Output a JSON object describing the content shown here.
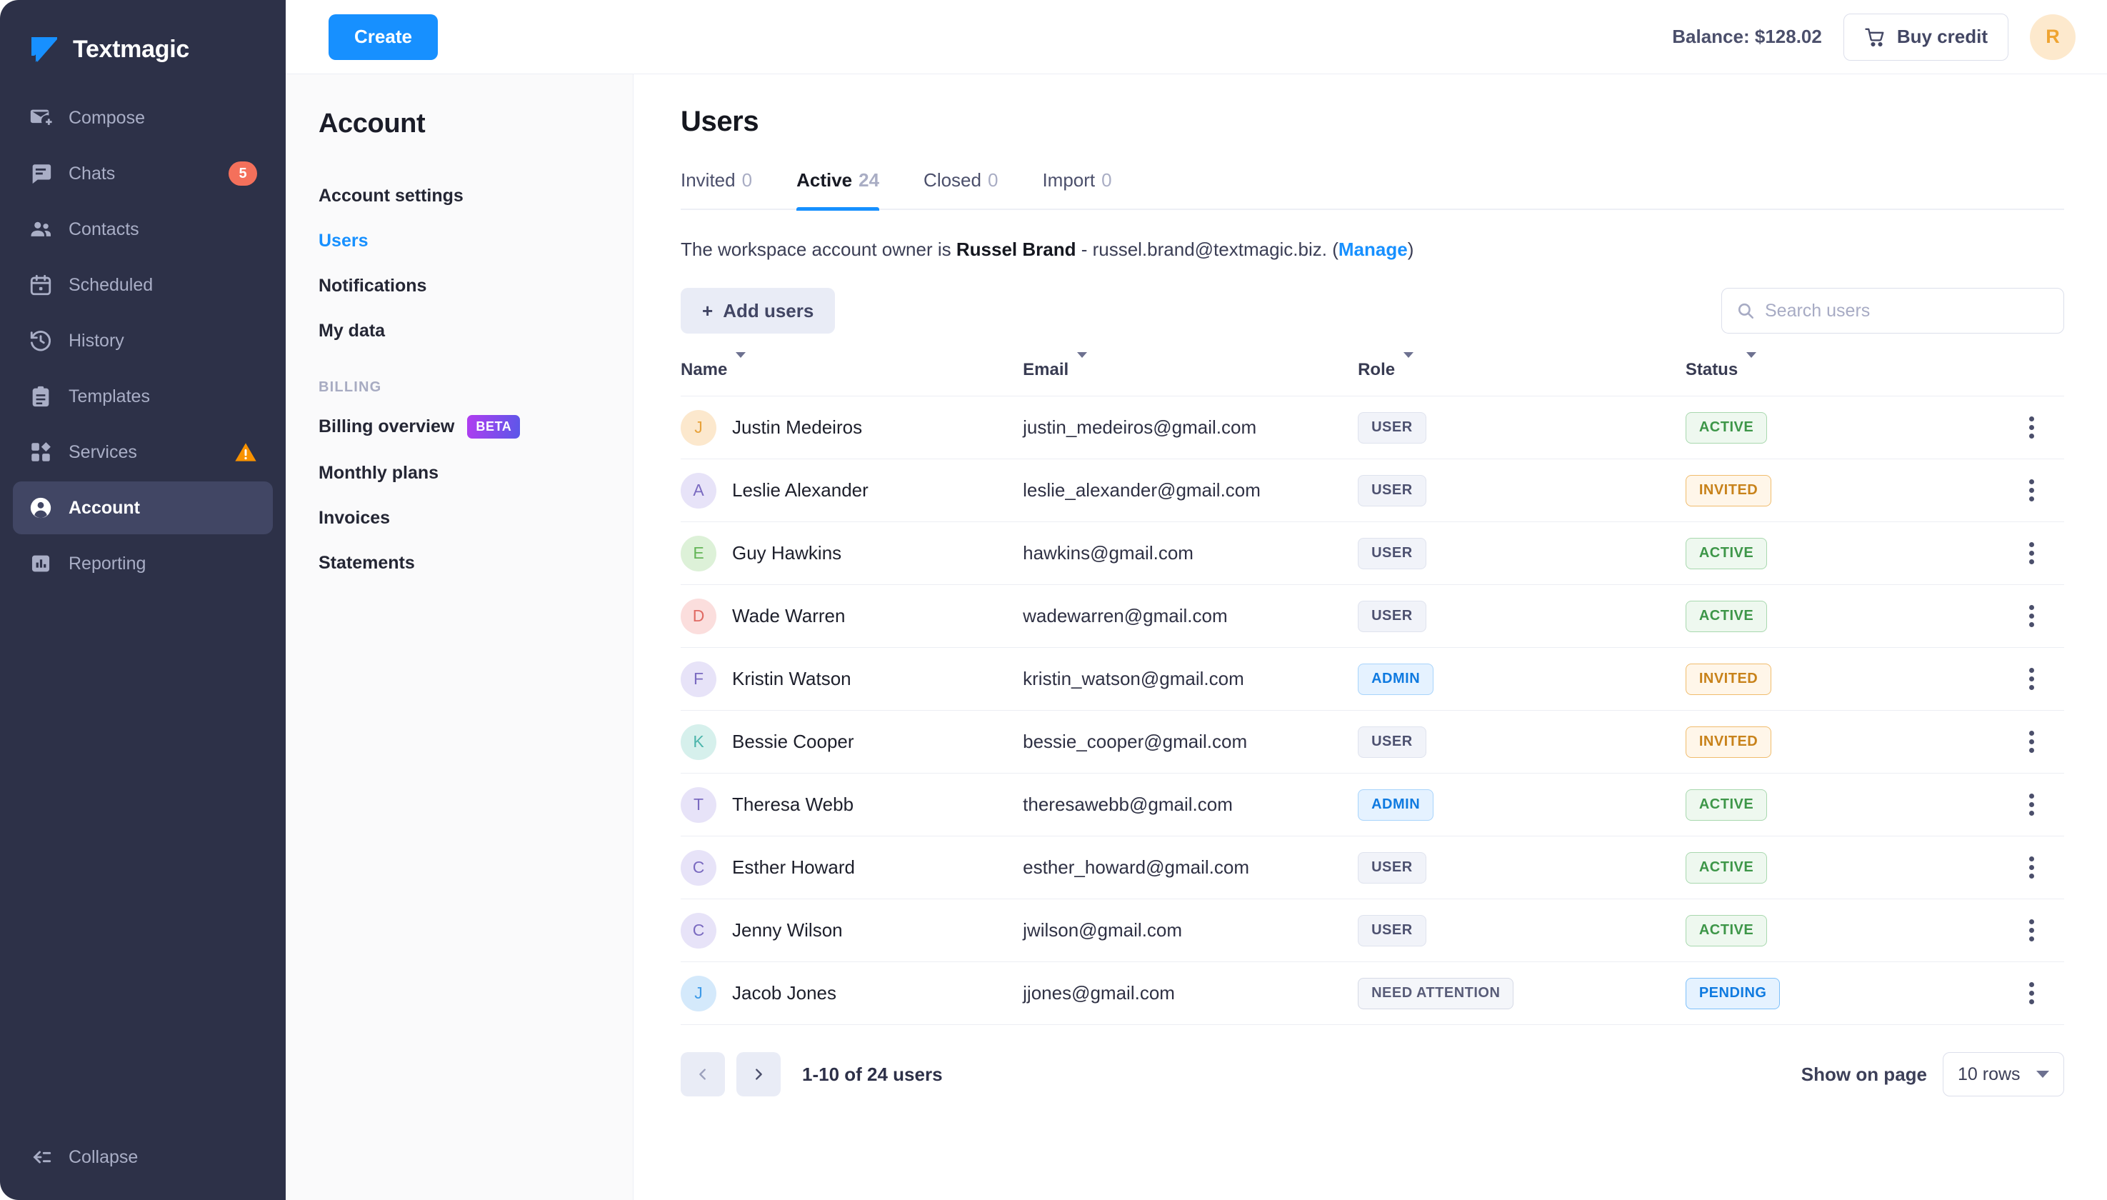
{
  "brand": {
    "name": "Textmagic",
    "logo_color": "#1790ff"
  },
  "sidebar": {
    "items": [
      {
        "label": "Compose",
        "icon": "compose-icon"
      },
      {
        "label": "Chats",
        "icon": "chat-icon",
        "badge": "5"
      },
      {
        "label": "Contacts",
        "icon": "contacts-icon"
      },
      {
        "label": "Scheduled",
        "icon": "calendar-icon"
      },
      {
        "label": "History",
        "icon": "history-icon"
      },
      {
        "label": "Templates",
        "icon": "templates-icon"
      },
      {
        "label": "Services",
        "icon": "services-icon",
        "warning": true
      },
      {
        "label": "Account",
        "icon": "account-icon",
        "active": true
      },
      {
        "label": "Reporting",
        "icon": "reporting-icon"
      }
    ],
    "collapse_label": "Collapse"
  },
  "topbar": {
    "create_label": "Create",
    "balance_label": "Balance: $128.02",
    "buy_credit_label": "Buy credit",
    "avatar_initial": "R"
  },
  "subnav": {
    "title": "Account",
    "items": [
      {
        "label": "Account settings"
      },
      {
        "label": "Users",
        "current": true
      },
      {
        "label": "Notifications"
      },
      {
        "label": "My data"
      }
    ],
    "group_label": "BILLING",
    "billing_items": [
      {
        "label": "Billing overview",
        "tag": "BETA"
      },
      {
        "label": "Monthly plans"
      },
      {
        "label": "Invoices"
      },
      {
        "label": "Statements"
      }
    ]
  },
  "main": {
    "page_title": "Users",
    "tabs": [
      {
        "label": "Invited",
        "count": "0",
        "active": false
      },
      {
        "label": "Active",
        "count": "24",
        "active": true
      },
      {
        "label": "Closed",
        "count": "0",
        "active": false
      },
      {
        "label": "Import",
        "count": "0",
        "active": false
      }
    ],
    "owner_notice": {
      "prefix": "The workspace account owner is ",
      "owner_name": "Russel Brand",
      "middle": " - russel.brand@textmagic.biz. (",
      "link": "Manage",
      "suffix": ")"
    },
    "add_users_label": "Add users",
    "search": {
      "placeholder": "Search users",
      "value": ""
    },
    "table": {
      "columns": [
        "Name",
        "Email",
        "Role",
        "Status"
      ],
      "rows": [
        {
          "initial": "J",
          "av_bg": "#fce8cd",
          "av_fg": "#e8a23a",
          "name": "Justin Medeiros",
          "email": "justin_medeiros@gmail.com",
          "role": "USER",
          "role_type": "user",
          "status": "ACTIVE",
          "status_type": "active"
        },
        {
          "initial": "A",
          "av_bg": "#e7e3f8",
          "av_fg": "#7a6ac0",
          "name": "Leslie Alexander",
          "email": "leslie_alexander@gmail.com",
          "role": "USER",
          "role_type": "user",
          "status": "INVITED",
          "status_type": "invited"
        },
        {
          "initial": "E",
          "av_bg": "#ddf1d8",
          "av_fg": "#63b557",
          "name": "Guy Hawkins",
          "email": "hawkins@gmail.com",
          "role": "USER",
          "role_type": "user",
          "status": "ACTIVE",
          "status_type": "active"
        },
        {
          "initial": "D",
          "av_bg": "#fbdedd",
          "av_fg": "#e06a63",
          "name": "Wade Warren",
          "email": "wadewarren@gmail.com",
          "role": "USER",
          "role_type": "user",
          "status": "ACTIVE",
          "status_type": "active"
        },
        {
          "initial": "F",
          "av_bg": "#e7e3f8",
          "av_fg": "#7a6ac0",
          "name": "Kristin Watson",
          "email": "kristin_watson@gmail.com",
          "role": "ADMIN",
          "role_type": "admin",
          "status": "INVITED",
          "status_type": "invited"
        },
        {
          "initial": "K",
          "av_bg": "#d6f0ec",
          "av_fg": "#4cb5ab",
          "name": "Bessie Cooper",
          "email": "bessie_cooper@gmail.com",
          "role": "USER",
          "role_type": "user",
          "status": "INVITED",
          "status_type": "invited"
        },
        {
          "initial": "T",
          "av_bg": "#e7e3f8",
          "av_fg": "#7a6ac0",
          "name": "Theresa Webb",
          "email": "theresawebb@gmail.com",
          "role": "ADMIN",
          "role_type": "admin",
          "status": "ACTIVE",
          "status_type": "active"
        },
        {
          "initial": "C",
          "av_bg": "#e7e3f8",
          "av_fg": "#7a6ac0",
          "name": "Esther Howard",
          "email": "esther_howard@gmail.com",
          "role": "USER",
          "role_type": "user",
          "status": "ACTIVE",
          "status_type": "active"
        },
        {
          "initial": "C",
          "av_bg": "#e7e3f8",
          "av_fg": "#7a6ac0",
          "name": "Jenny Wilson",
          "email": "jwilson@gmail.com",
          "role": "USER",
          "role_type": "user",
          "status": "ACTIVE",
          "status_type": "active"
        },
        {
          "initial": "J",
          "av_bg": "#d4e9fb",
          "av_fg": "#3d9ae8",
          "name": "Jacob Jones",
          "email": "jjones@gmail.com",
          "role": "NEED ATTENTION",
          "role_type": "attn",
          "status": "PENDING",
          "status_type": "pending"
        }
      ]
    },
    "pagination": {
      "range_text": "1-10 of 24 users",
      "show_label": "Show on page",
      "rows_value": "10 rows"
    }
  }
}
